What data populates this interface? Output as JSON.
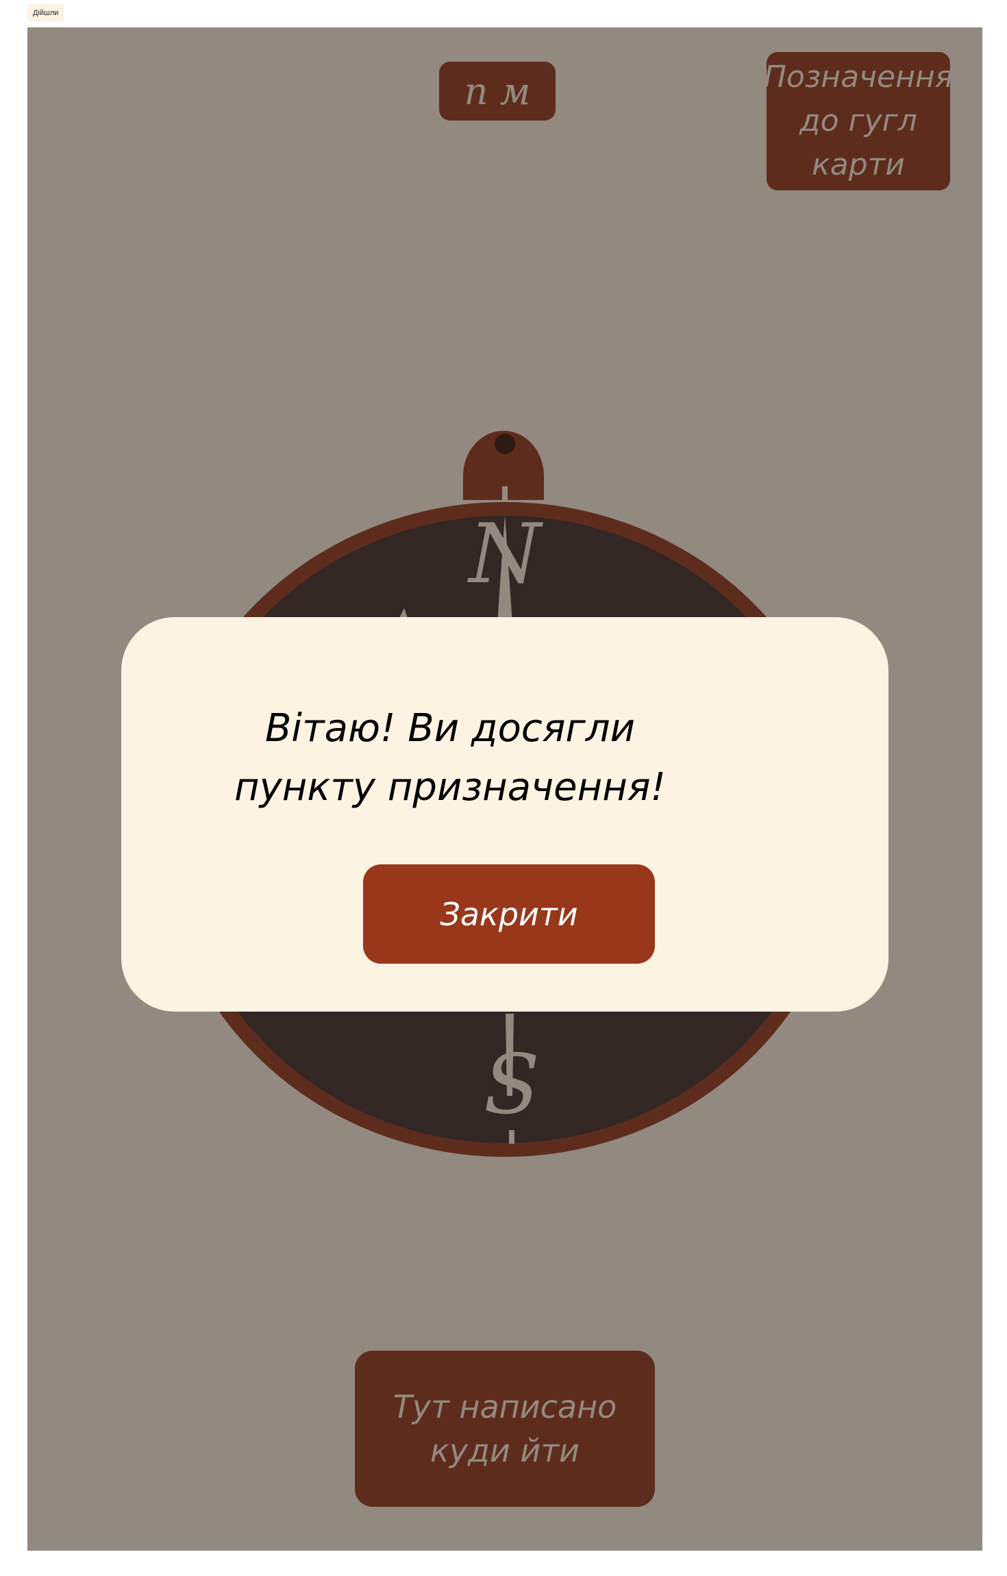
{
  "tab": {
    "label": "Дійшли"
  },
  "header": {
    "distance_label": "n м"
  },
  "map_button": {
    "label": "Позначення до гугл карти"
  },
  "compass": {
    "north": "N",
    "south": "S"
  },
  "modal": {
    "message": "Вітаю! Ви досягли пункту призначення!",
    "close_label": "Закрити"
  },
  "hint": {
    "label": "Тут написано куди йти"
  },
  "colors": {
    "background": "#928a80",
    "button": "#5e2c1d",
    "compass_face": "#332725",
    "modal": "#fdf3e3",
    "accent": "#98371a"
  }
}
